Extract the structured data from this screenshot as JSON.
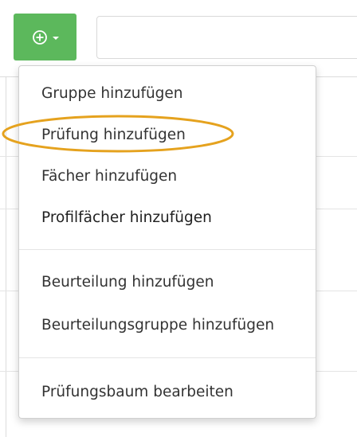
{
  "toolbar": {
    "add_icon": "plus-circle-icon",
    "dropdown_icon": "caret-down-icon",
    "accent_color": "#5cb85c",
    "search_value": ""
  },
  "menu": {
    "items": [
      {
        "label": "Gruppe hinzufügen"
      },
      {
        "label": "Prüfung hinzufügen",
        "highlighted": true
      },
      {
        "label": "Fächer hinzufügen"
      },
      {
        "label": "Profilfächer hinzufügen"
      },
      {
        "label": "Beurteilung hinzufügen"
      },
      {
        "label": "Beurteilungsgruppe hinzufügen"
      },
      {
        "label": "Prüfungsbaum bearbeiten"
      }
    ],
    "highlight_color": "#e5a21e"
  }
}
